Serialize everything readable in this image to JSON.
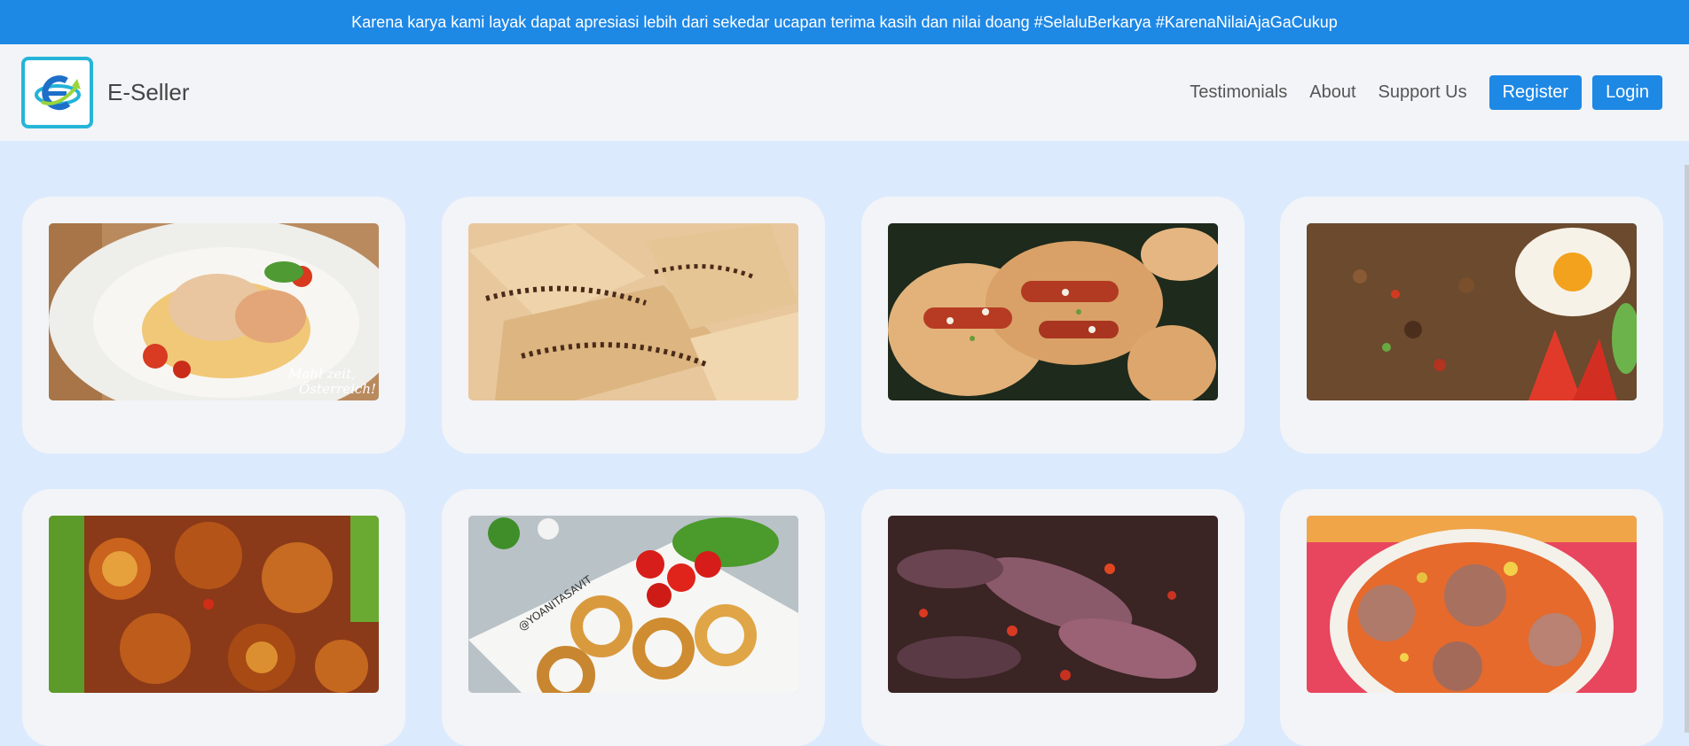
{
  "announcement": "Karena karya kami layak dapat apresiasi lebih dari sekedar ucapan terima kasih dan nilai doang #SelaluBerkarya #KarenaNilaiAjaGaCukup",
  "brand": {
    "name": "E-Seller",
    "logo_icon": "e-seller-logo-icon"
  },
  "nav": {
    "links": [
      "Testimonials",
      "About",
      "Support Us"
    ],
    "register_label": "Register",
    "login_label": "Login"
  },
  "colors": {
    "primary": "#1e88e5",
    "page_bg": "#dceafd",
    "card_bg": "#f2f4f7"
  },
  "products": [
    {
      "image": "grilled-chicken-pasta-photo"
    },
    {
      "image": "crepes-chocolate-sprinkles-photo"
    },
    {
      "image": "sausage-bread-rolls-photo"
    },
    {
      "image": "fried-rice-egg-photo"
    },
    {
      "image": "spicy-shrimp-photo"
    },
    {
      "image": "onion-rings-tomatoes-photo"
    },
    {
      "image": "squid-ink-stew-photo"
    },
    {
      "image": "meatball-soup-bowl-photo"
    }
  ]
}
